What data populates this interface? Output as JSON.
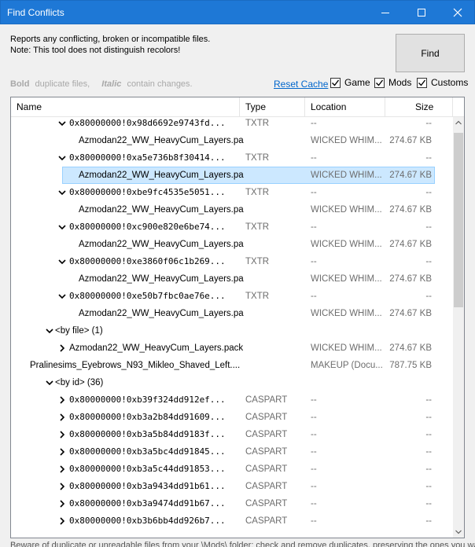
{
  "window": {
    "title": "Find Conflicts"
  },
  "description": {
    "line1": "Reports any conflicting, broken or incompatible files.",
    "line2": "Note: This tool does not distinguish recolors!"
  },
  "find_button": "Find",
  "legend": {
    "bold": "Bold",
    "bold_text": "duplicate files,",
    "italic": "Italic",
    "italic_text": "contain changes."
  },
  "reset_cache": "Reset Cache",
  "filters": [
    {
      "label": "Game",
      "checked": true
    },
    {
      "label": "Mods",
      "checked": true
    },
    {
      "label": "Customs",
      "checked": true
    }
  ],
  "columns": {
    "name": "Name",
    "type": "Type",
    "location": "Location",
    "size": "Size"
  },
  "rows": [
    {
      "indent": 2,
      "chevron": "down",
      "name": "0x80000000!0x98d6692e9743fd...",
      "mono": true,
      "type": "TXTR",
      "location": "--",
      "size": "--"
    },
    {
      "indent": 3,
      "chevron": "",
      "name": "Azmodan22_WW_HeavyCum_Layers.pa...",
      "mono": false,
      "type": "",
      "location": "WICKED WHIM...",
      "size": "274.67 KB"
    },
    {
      "indent": 2,
      "chevron": "down",
      "name": "0x80000000!0xa5e736b8f30414...",
      "mono": true,
      "type": "TXTR",
      "location": "--",
      "size": "--"
    },
    {
      "indent": 3,
      "chevron": "",
      "name": "Azmodan22_WW_HeavyCum_Layers.pa...",
      "mono": false,
      "type": "",
      "location": "WICKED WHIM...",
      "size": "274.67 KB",
      "selected": true
    },
    {
      "indent": 2,
      "chevron": "down",
      "name": "0x80000000!0xbe9fc4535e5051...",
      "mono": true,
      "type": "TXTR",
      "location": "--",
      "size": "--"
    },
    {
      "indent": 3,
      "chevron": "",
      "name": "Azmodan22_WW_HeavyCum_Layers.pa...",
      "mono": false,
      "type": "",
      "location": "WICKED WHIM...",
      "size": "274.67 KB"
    },
    {
      "indent": 2,
      "chevron": "down",
      "name": "0x80000000!0xc900e820e6be74...",
      "mono": true,
      "type": "TXTR",
      "location": "--",
      "size": "--"
    },
    {
      "indent": 3,
      "chevron": "",
      "name": "Azmodan22_WW_HeavyCum_Layers.pa...",
      "mono": false,
      "type": "",
      "location": "WICKED WHIM...",
      "size": "274.67 KB"
    },
    {
      "indent": 2,
      "chevron": "down",
      "name": "0x80000000!0xe3860f06c1b269...",
      "mono": true,
      "type": "TXTR",
      "location": "--",
      "size": "--"
    },
    {
      "indent": 3,
      "chevron": "",
      "name": "Azmodan22_WW_HeavyCum_Layers.pa...",
      "mono": false,
      "type": "",
      "location": "WICKED WHIM...",
      "size": "274.67 KB"
    },
    {
      "indent": 2,
      "chevron": "down",
      "name": "0x80000000!0xe50b7fbc0ae76e...",
      "mono": true,
      "type": "TXTR",
      "location": "--",
      "size": "--"
    },
    {
      "indent": 3,
      "chevron": "",
      "name": "Azmodan22_WW_HeavyCum_Layers.pa...",
      "mono": false,
      "type": "",
      "location": "WICKED WHIM...",
      "size": "274.67 KB"
    },
    {
      "indent": 1,
      "chevron": "down",
      "name": "<by file> (1)",
      "mono": false,
      "type": "",
      "location": "",
      "size": ""
    },
    {
      "indent": 2,
      "chevron": "right",
      "name": "Azmodan22_WW_HeavyCum_Layers.pack...",
      "mono": false,
      "type": "",
      "location": "WICKED WHIM...",
      "size": "274.67 KB"
    },
    {
      "indent": 0,
      "chevron": "",
      "name": "Pralinesims_Eyebrows_N93_Mikleo_Shaved_Left....",
      "mono": false,
      "type": "",
      "location": "MAKEUP (Docu...",
      "size": "787.75 KB"
    },
    {
      "indent": 1,
      "chevron": "down",
      "name": "<by id> (36)",
      "mono": false,
      "type": "",
      "location": "",
      "size": ""
    },
    {
      "indent": 2,
      "chevron": "right",
      "name": "0x80000000!0xb39f324dd912ef...",
      "mono": true,
      "type": "CASPART",
      "location": "--",
      "size": "--"
    },
    {
      "indent": 2,
      "chevron": "right",
      "name": "0x80000000!0xb3a2b84dd91609...",
      "mono": true,
      "type": "CASPART",
      "location": "--",
      "size": "--"
    },
    {
      "indent": 2,
      "chevron": "right",
      "name": "0x80000000!0xb3a5b84dd9183f...",
      "mono": true,
      "type": "CASPART",
      "location": "--",
      "size": "--"
    },
    {
      "indent": 2,
      "chevron": "right",
      "name": "0x80000000!0xb3a5bc4dd91845...",
      "mono": true,
      "type": "CASPART",
      "location": "--",
      "size": "--"
    },
    {
      "indent": 2,
      "chevron": "right",
      "name": "0x80000000!0xb3a5c44dd91853...",
      "mono": true,
      "type": "CASPART",
      "location": "--",
      "size": "--"
    },
    {
      "indent": 2,
      "chevron": "right",
      "name": "0x80000000!0xb3a9434dd91b61...",
      "mono": true,
      "type": "CASPART",
      "location": "--",
      "size": "--"
    },
    {
      "indent": 2,
      "chevron": "right",
      "name": "0x80000000!0xb3a9474dd91b67...",
      "mono": true,
      "type": "CASPART",
      "location": "--",
      "size": "--"
    },
    {
      "indent": 2,
      "chevron": "right",
      "name": "0x80000000!0xb3b6bb4dd926b7...",
      "mono": true,
      "type": "CASPART",
      "location": "--",
      "size": "--"
    }
  ],
  "footer": "Beware of duplicate or unreadable files from your \\Mods\\ folder; check and remove duplicates, preserving the ones you want."
}
